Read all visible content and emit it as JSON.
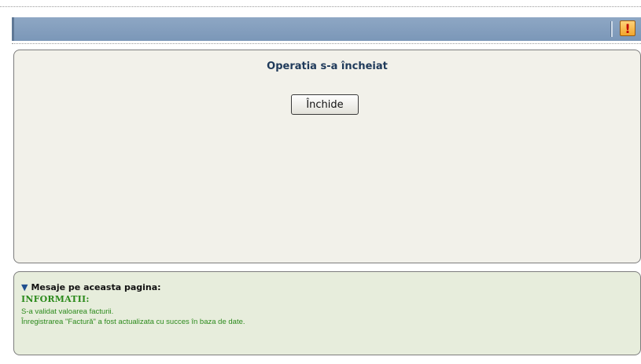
{
  "main": {
    "title": "Operatia s-a încheiat",
    "close_button_label": "Închide"
  },
  "messages": {
    "header": "Mesaje pe aceasta pagina:",
    "toggle_icon": "triangle-down-icon",
    "section_title": "INFORMATII:",
    "lines": [
      "S-a validat valoarea facturii.",
      "Înregistrarea \"Factură\" a fost actualizata cu succes în baza de date."
    ]
  },
  "toolbar": {
    "alert_icon": "exclamation-icon",
    "alert_glyph": "!"
  },
  "colors": {
    "title_bar": "#7b97b8",
    "panel_bg": "#f2f1ea",
    "message_bg": "#e7eddc",
    "info_text": "#2c8a1c",
    "title_text": "#1f3a5a"
  }
}
